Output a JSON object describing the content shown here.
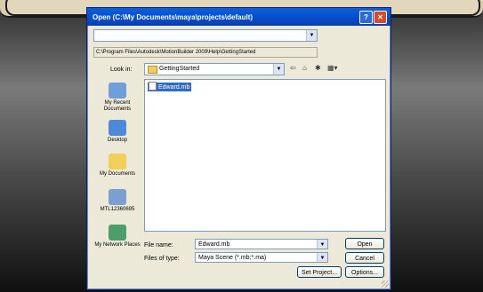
{
  "dialog": {
    "title": "Open (C:\\My Documents\\maya\\projects\\default)",
    "help_glyph": "?",
    "close_glyph": "✕"
  },
  "top_combo": {
    "value": ""
  },
  "path_text": "C:\\Program Files\\Autodesk\\MotionBuilder 2009\\Help\\GettingStarted",
  "lookin": {
    "label": "Look in:",
    "value": "GettingStarted"
  },
  "toolbar": {
    "back_glyph": "⇦",
    "up_glyph": "⌂",
    "newfolder_glyph": "✱",
    "views_glyph": "▦▾"
  },
  "places": [
    {
      "label": "My Recent Documents",
      "icon": "recent-documents-icon",
      "color": "#6f9fd8"
    },
    {
      "label": "Desktop",
      "icon": "desktop-icon",
      "color": "#4e88d8"
    },
    {
      "label": "My Documents",
      "icon": "my-documents-icon",
      "color": "#f2cf5b"
    },
    {
      "label": "MTL12360695",
      "icon": "my-computer-icon",
      "color": "#7a9fd0"
    },
    {
      "label": "My Network Places",
      "icon": "network-places-icon",
      "color": "#4c9e6a"
    }
  ],
  "files": [
    {
      "name": "Edward.mb"
    }
  ],
  "filename": {
    "label": "File name:",
    "value": "Edward.mb"
  },
  "filetype": {
    "label": "Files of type:",
    "value": "Maya Scene (*.mb;*.ma)"
  },
  "buttons": {
    "open": "Open",
    "cancel": "Cancel",
    "set_project": "Set Project...",
    "options": "Options..."
  }
}
